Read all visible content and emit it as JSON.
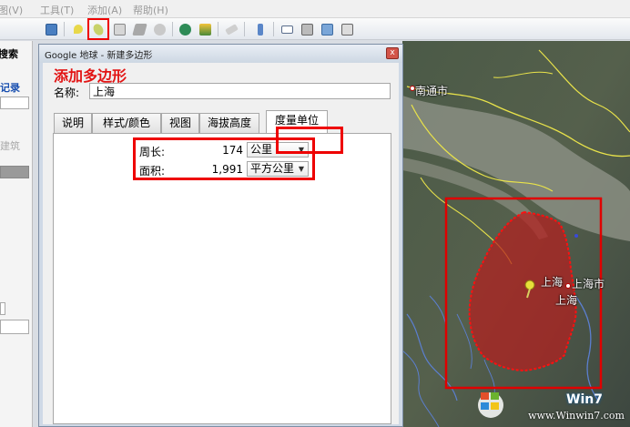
{
  "menu": {
    "items": [
      "图(V)",
      "工具(T)",
      "添加(A)",
      "帮助(H)"
    ]
  },
  "left_panel": {
    "search": "搜索",
    "records": "记录",
    "build": "建筑"
  },
  "dialog": {
    "window_title": "Google 地球 - 新建多边形",
    "annotation": "添加多边形",
    "name_label": "名称:",
    "name_value": "上海",
    "close": "x",
    "tabs": [
      "说明",
      "样式/颜色",
      "视图",
      "海拔高度",
      "度量单位"
    ],
    "active_tab": "度量单位",
    "measurements": [
      {
        "label": "周长:",
        "value": "174",
        "unit": "公里"
      },
      {
        "label": "面积:",
        "value": "1,991",
        "unit": "平方公里"
      }
    ]
  },
  "map": {
    "labels": {
      "nantong": "南通市",
      "shanghai_pin": "上海",
      "shanghai_city": "上海市",
      "shanghai_center": "上海"
    },
    "polygon_color": "#b41e1e",
    "highlight_color": "#e00000",
    "watermark_brand": "Win7",
    "watermark_url": "www.Winwin7.com"
  }
}
